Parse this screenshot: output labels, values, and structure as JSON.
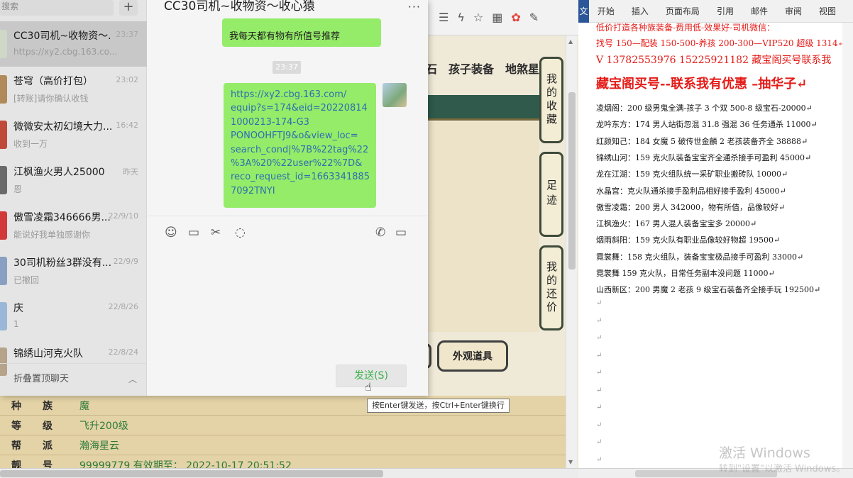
{
  "browser": {
    "toolbar_icons": [
      "hamburger-icon",
      "lightning-icon",
      "star-icon",
      "grid-icon",
      "game-icon",
      "wrench-icon"
    ],
    "game_tabs": [
      "石",
      "孩子装备",
      "地煞星"
    ],
    "side_tabs": [
      "我的收藏",
      "足迹",
      "我的还价"
    ],
    "appearance_button": "外观道具",
    "info_rows": [
      {
        "k1": "种",
        "k2": "族",
        "value": "魔"
      },
      {
        "k1": "等",
        "k2": "级",
        "value": "飞升200级"
      },
      {
        "k1": "帮",
        "k2": "派",
        "value": "瀚海星云"
      },
      {
        "k1": "靓",
        "k2": "号",
        "value": "99999779    有效期至： 2022-10-17 20:51:52"
      }
    ]
  },
  "wechat": {
    "search_placeholder": "搜索",
    "add_button": "+",
    "chats": [
      {
        "name": "CC30司机~收物资～...",
        "preview": "https://xy2.cbg.163.co...",
        "time": "23:37",
        "active": true,
        "avatar_color": "#cfd8c6"
      },
      {
        "name": "苍穹（高价打包）",
        "preview": "[转账]请你确认收钱",
        "time": "23:02",
        "active": false,
        "avatar_color": "#b08a5a"
      },
      {
        "name": "微微安太初幻境大力...",
        "preview": "收到一万",
        "time": "16:42",
        "active": false,
        "avatar_color": "#c04a3a"
      },
      {
        "name": "江枫渔火男人25000",
        "preview": "恩",
        "time": "昨天",
        "active": false,
        "avatar_color": "#6a6a6a"
      },
      {
        "name": "傲雪凌霜346666男...",
        "preview": "能说好我单独感谢你",
        "time": "22/9/10",
        "active": false,
        "avatar_color": "#d23a3a"
      },
      {
        "name": "30司机粉丝3群没有...",
        "preview": "已撤回",
        "time": "22/9/9",
        "active": false,
        "avatar_color": "#8aa0c2"
      },
      {
        "name": "庆",
        "preview": "1",
        "time": "22/8/26",
        "active": false,
        "avatar_color": "#9ab7d8"
      },
      {
        "name": "锦绣山河克火队",
        "preview": "",
        "time": "22/8/24",
        "active": false,
        "avatar_color": "#b6a48a"
      }
    ],
    "fold_label": "折叠置顶聊天",
    "chat_title": "CC30司机~收物资～收心猿",
    "more_label": "···",
    "partial_message": "我每天都有物有所值号推荐",
    "time_chip": "23:37",
    "link_message": "https://xy2.cbg.163.com/equip?s=174&eid=20220814 1000213-174-G3 PONOOHFTJ9&o&view_loc=search_cond|%7B%22tag%22 %3A%20%22user%22%7D& reco_request_id=1663341885 7092TNYI",
    "link_lines": [
      "https://xy2.cbg.163.com/",
      "equip?s=174&eid=20220814",
      "1000213-174-G3",
      "PONOOHFTJ9&o&view_loc=",
      "search_cond|%7B%22tag%22",
      "%3A%20%22user%22%7D&",
      "reco_request_id=1663341885",
      "7092TNYI"
    ],
    "tools": [
      "emoji-icon",
      "folder-icon",
      "scissors-icon",
      "chat-bubble-icon",
      "phone-icon",
      "video-icon"
    ],
    "send_button": "发送(S)",
    "send_tooltip": "按Enter键发送，按Ctrl+Enter键换行"
  },
  "word": {
    "tabs": [
      "文件",
      "开始",
      "插入",
      "页面布局",
      "引用",
      "邮件",
      "审阅",
      "视图"
    ],
    "red_lines": [
      "低价打造各种族装备-费用低-效果好-司机微信：",
      "找号 150—配装 150-500-养孩 200-300—VIP520 超级 1314↵",
      "V 13782553976    15225921182  藏宝阁买号联系我",
      "藏宝阁买号--联系我有优惠 –抽华子↵"
    ],
    "body_lines": [
      "凌烟阁：200 级男鬼全满-孩子 3 个双 500-8 级宝石-20000↵",
      "龙吟东方：174 男人站街忽混 31.8 强混 36 任务通杀 11000↵",
      "红颜知己：184 女魔 5 破传世金麟 2 老孩装备齐全 38888↵",
      "锦绣山河：159 克火队装备宝宝齐全通杀接手可盈利 45000↵",
      "龙在江湖：159 克火组队统一采矿职业搬砖队 10000↵",
      "水晶宫：克火队通杀接手盈利品相好接手盈利 45000↵",
      "傲雪凌霜：200 男人 342000，物有所值，品像较好↵",
      "江枫渔火：167 男人混人装备宝宝多 20000↵",
      "烟雨斜阳：159 克火队有职业品像较好物超 19500↵",
      "霓裳舞：158 克火组队，装备宝宝极品接手可盈利 33000↵",
      "霓裳舞 159 克火队，日常任务副本没问题 11000↵",
      "山西新区：200 男魔 2 老孩 9 级宝石装备齐全接手玩 192500↵"
    ],
    "paragraph_marks": [
      "↵",
      "↵",
      "↵",
      "↵",
      "↵",
      "↵",
      "↵",
      "↵",
      "↵",
      "↵"
    ],
    "watermark_title": "激活 Windows",
    "watermark_sub": "转到\"设置\"以激活 Windows。"
  },
  "colors": {
    "bubble_green": "#95ec69",
    "word_red": "#e41b17",
    "word_blue": "#2b579a",
    "game_green_text": "#2d7a3c"
  }
}
